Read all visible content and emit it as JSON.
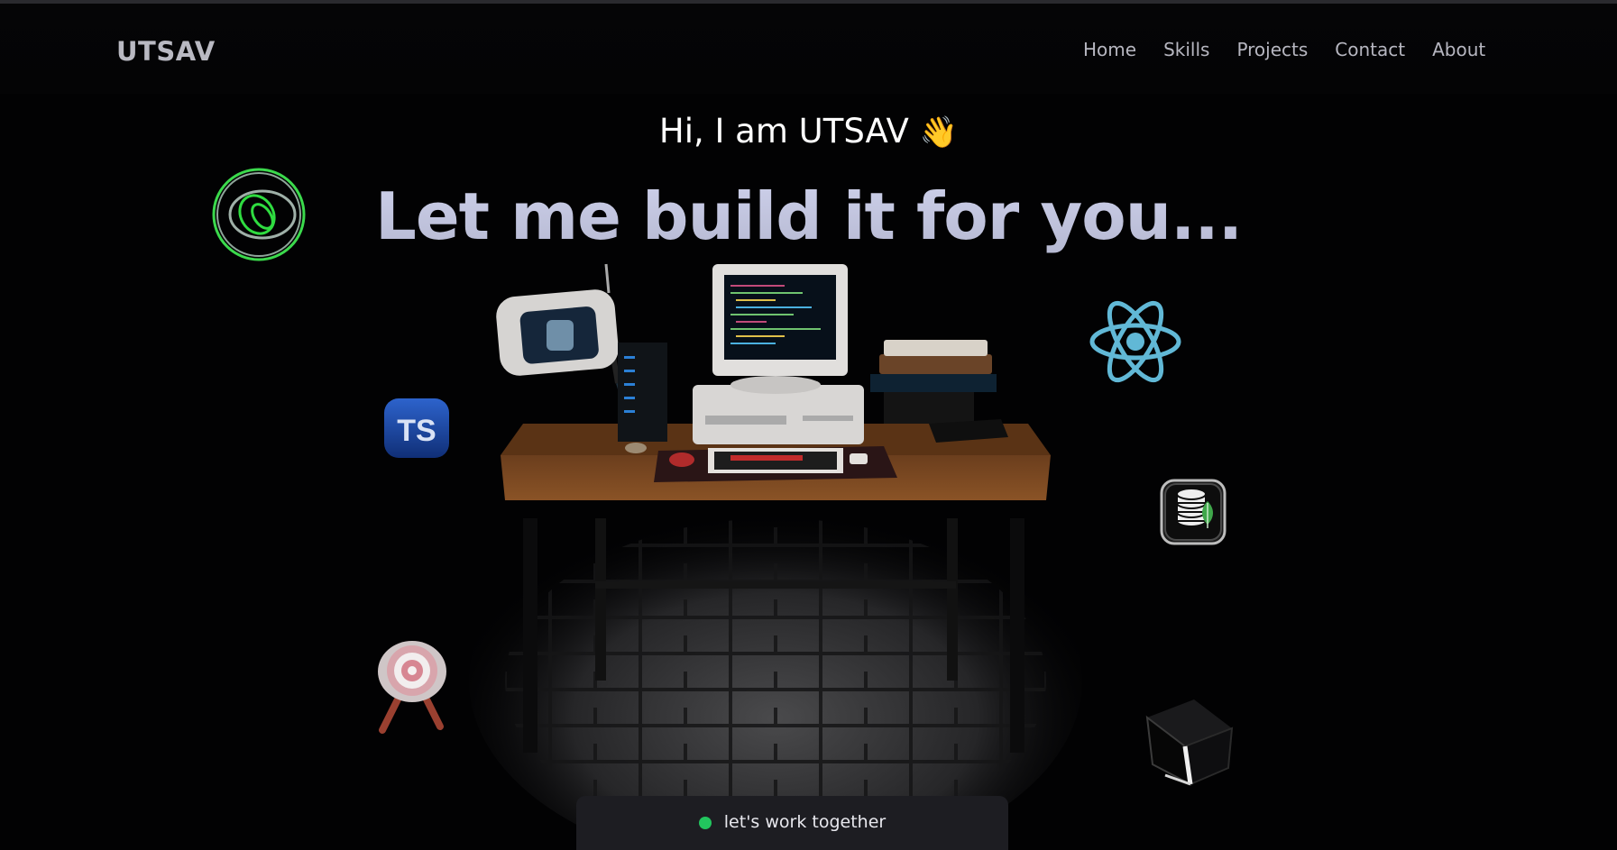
{
  "header": {
    "logo": "UTSAV",
    "nav": [
      "Home",
      "Skills",
      "Projects",
      "Contact",
      "About"
    ]
  },
  "hero": {
    "greeting": "Hi, I am UTSAV",
    "wave_emoji": "👋",
    "headline": "Let me build it for you..."
  },
  "cta": {
    "label": "let's work together",
    "status_color": "#22c55e"
  },
  "icons": {
    "left_top": "rings-logo-icon",
    "left_middle": "typescript-icon",
    "left_bottom": "target-icon",
    "right_top": "react-icon",
    "right_middle": "mongodb-database-icon",
    "right_bottom": "cube-icon"
  },
  "accent_colors": {
    "react": "#61b8d6",
    "rings": "#2fdc40",
    "typescript": "#2a5ec4"
  }
}
